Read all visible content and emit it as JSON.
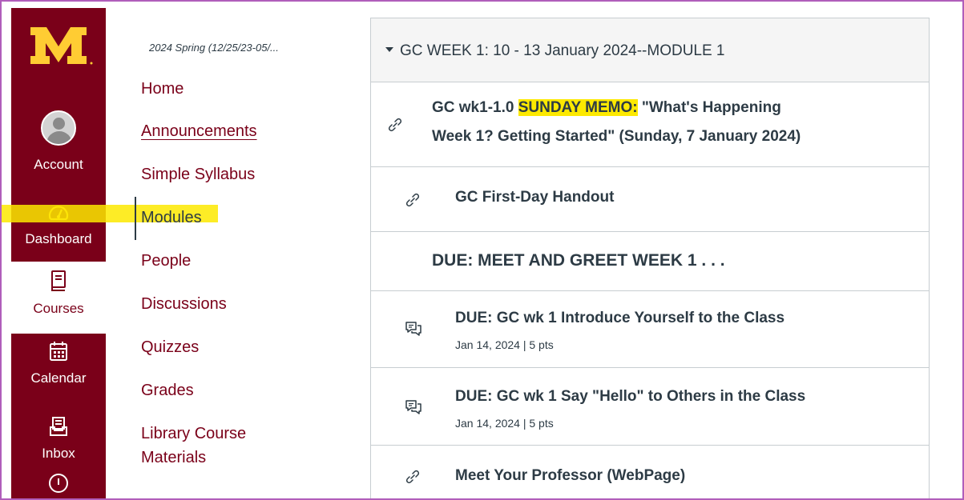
{
  "global_nav": {
    "logo": "M",
    "items": [
      {
        "label": "Account",
        "icon": "account-avatar-icon"
      },
      {
        "label": "Dashboard",
        "icon": "dashboard-gauge-icon"
      },
      {
        "label": "Courses",
        "icon": "courses-book-icon"
      },
      {
        "label": "Calendar",
        "icon": "calendar-icon"
      },
      {
        "label": "Inbox",
        "icon": "inbox-icon"
      }
    ]
  },
  "course_nav": {
    "term": "2024 Spring (12/25/23-05/...",
    "links": [
      {
        "label": "Home"
      },
      {
        "label": "Announcements"
      },
      {
        "label": "Simple Syllabus"
      },
      {
        "label": "Modules"
      },
      {
        "label": "People"
      },
      {
        "label": "Discussions"
      },
      {
        "label": "Quizzes"
      },
      {
        "label": "Grades"
      },
      {
        "label": "Library Course"
      },
      {
        "label": "Materials"
      }
    ]
  },
  "module": {
    "title": "GC WEEK 1: 10 - 13 January 2024--MODULE 1",
    "items": [
      {
        "prefix": "GC wk1-1.0 ",
        "highlight": "SUNDAY MEMO:",
        "suffix": " \"What's Happening",
        "line2": "Week 1? Getting Started\" (Sunday, 7 January 2024)",
        "icon": "link-icon"
      },
      {
        "title": "GC First-Day Handout",
        "icon": "link-icon"
      },
      {
        "title": "DUE: MEET AND GREET WEEK 1 . . ."
      },
      {
        "title": "DUE: GC wk 1 Introduce Yourself to the Class",
        "meta": "Jan 14, 2024  |  5 pts",
        "icon": "discussion-icon"
      },
      {
        "title": "DUE: GC wk 1 Say \"Hello\" to Others in the Class",
        "meta": "Jan 14, 2024  |  5 pts",
        "icon": "discussion-icon"
      },
      {
        "title": "Meet Your Professor (WebPage)",
        "icon": "link-icon"
      }
    ]
  },
  "colors": {
    "brand_maroon": "#7a0019",
    "brand_gold": "#ffcc33",
    "highlight_yellow": "#fde900",
    "frame_border": "#b05dbb"
  }
}
